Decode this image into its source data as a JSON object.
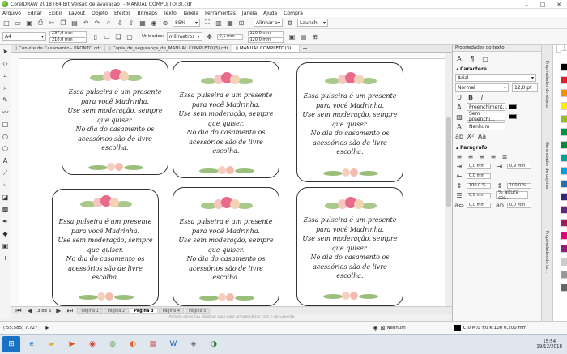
{
  "window": {
    "title": "CorelDRAW 2018 (64 Bit Versão de avaliação) - MANUAL COMPLETO(3).cdr",
    "minimize": "–",
    "maximize": "□",
    "close": "✕"
  },
  "menu": [
    "Arquivo",
    "Editar",
    "Exibir",
    "Layout",
    "Objeto",
    "Efeitos",
    "Bitmaps",
    "Texto",
    "Tabela",
    "Ferramentas",
    "Janela",
    "Ajuda",
    "Compra"
  ],
  "toolbar": {
    "zoom": "85%",
    "align_label": "Alinhar a",
    "launch_label": "Launch"
  },
  "property_bar": {
    "page_size": "A4",
    "width": "297,0 mm",
    "height": "210,0 mm",
    "units_label": "Unidades:",
    "units_value": "milímetros",
    "nudge": "0,1 mm",
    "dup_x": "120,0 mm",
    "dup_y": "120,0 mm"
  },
  "doc_tabs": [
    {
      "label": "Convite de Casamento - PRONTO.cdr"
    },
    {
      "label": "Cópia_de_segurança_de_MANUAL COMPLETO(3).cdr"
    },
    {
      "label": "MANUAL COMPLETO(3)..."
    }
  ],
  "card_text": [
    "Essa pulseira é um presente",
    "para você Madrinha.",
    "Use sem moderação, sempre",
    "que quiser.",
    "No dia do casamento os",
    "acessórios são de livre",
    "escolha."
  ],
  "pages": {
    "counter": "3 de 5",
    "tabs": [
      "Página 1",
      "Página 2",
      "Página 3",
      "Página 4",
      "Página 5"
    ],
    "active": "Página 3"
  },
  "hint": "Arraste cores (ou objetos) aqui para armazená-las com o documento",
  "status": {
    "coords": "( 55,585; 7,727 )",
    "fill_label": "Nenhum",
    "color_info": "C:0 M:0 Y:0 K:100  0,200 mm"
  },
  "panel": {
    "title": "Propriedades do texto",
    "character_label": "Caractere",
    "font": "Arial",
    "style": "Normal",
    "size": "12,0 pt",
    "fill1_label": "Preenchiment...",
    "fill2_label": "Sem preenchi...",
    "outline_label": "Nenhum",
    "paragraph_label": "Parágrafo",
    "indent1": "0,0 mm",
    "indent2": "0,0 mm",
    "indent3": "0,0 mm",
    "indent4": "0,9 mm",
    "line1": "100,0 %",
    "line2": "100,0 %",
    "line_type": "% altura car...",
    "spacing1": "0,0 mm",
    "spacing2": "0,0 mm"
  },
  "side_tabs": [
    "Propriedades do objeto",
    "Gerenciador de objetos",
    "Propriedades do te..."
  ],
  "palette": [
    "#ffffff",
    "#000000",
    "#e31e24",
    "#f39200",
    "#ffed00",
    "#95c11f",
    "#009640",
    "#008d36",
    "#00a19a",
    "#009fe3",
    "#1d71b8",
    "#312783",
    "#662483",
    "#a3195b",
    "#e6007e",
    "#951b81",
    "#cccccc",
    "#999999",
    "#666666"
  ],
  "taskbar": {
    "time": "15:54",
    "date": "19/12/2018"
  }
}
